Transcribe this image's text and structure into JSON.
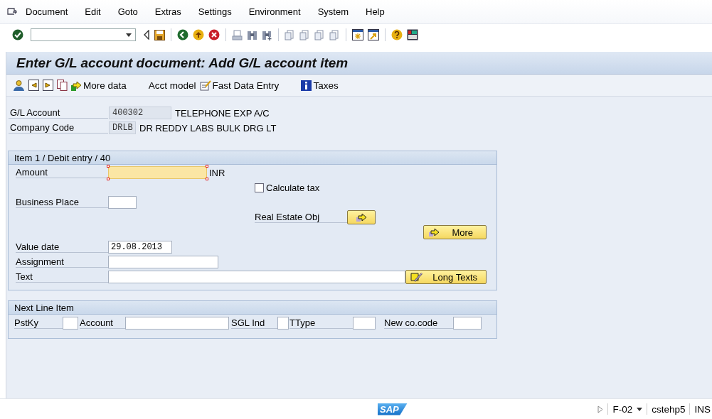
{
  "menu_bar": [
    "Document",
    "Edit",
    "Goto",
    "Extras",
    "Settings",
    "Environment",
    "System",
    "Help"
  ],
  "title": "Enter G/L account document: Add G/L account item",
  "app_toolbar": [
    {
      "kind": "person"
    },
    {
      "kind": "prev"
    },
    {
      "kind": "next"
    },
    {
      "kind": "copy"
    },
    {
      "kind": "more",
      "label": "More data"
    },
    {
      "kind": "text",
      "label": "Acct model"
    },
    {
      "kind": "fast",
      "label": "Fast Data Entry"
    },
    {
      "kind": "info",
      "label": "Taxes"
    }
  ],
  "header_fields": [
    {
      "label": "G/L Account",
      "value": "400302",
      "description": "TELEPHONE EXP A/C"
    },
    {
      "label": "Company Code",
      "value": "DRLB",
      "description": "DR REDDY LABS BULK DRG LT"
    }
  ],
  "item_group": {
    "title": "Item 1 / Debit entry / 40",
    "amount": {
      "label": "Amount",
      "currency": "INR",
      "focused": true
    },
    "calculate_tax": {
      "label": "Calculate tax",
      "checked": false
    },
    "business_place": {
      "label": "Business Place"
    },
    "real_estate": {
      "label": "Real Estate Obj"
    },
    "more_button": "More",
    "value_date": {
      "label": "Value date",
      "value": "29.08.2013"
    },
    "assignment": {
      "label": "Assignment"
    },
    "text": {
      "label": "Text"
    },
    "long_texts_button": "Long Texts"
  },
  "next_line_item": {
    "title": "Next Line Item",
    "fields": [
      {
        "label": "PstKy"
      },
      {
        "label": "Account"
      },
      {
        "label": "SGL Ind"
      },
      {
        "label": "TType"
      },
      {
        "label": "New co.code"
      }
    ]
  },
  "status_bar": {
    "logo": "SAP",
    "transaction": "F-02",
    "server": "cstehp5",
    "mode": "INS"
  }
}
